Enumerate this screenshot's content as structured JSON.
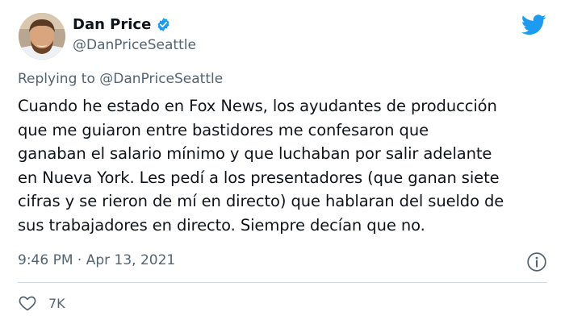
{
  "author": {
    "name": "Dan Price",
    "handle": "@DanPriceSeattle"
  },
  "reply_to": "Replying to @DanPriceSeattle",
  "body_lines": [
    "Cuando he estado en Fox News, los ayudantes de producción",
    "que me guiaron entre bastidores me confesaron que",
    "ganaban el salario mínimo y que luchaban por salir adelante",
    "en Nueva York. Les pedí a los presentadores (que ganan siete",
    "cifras y se rieron de mí en directo) que hablaran del sueldo de",
    "sus trabajadores en directo. Siempre decían que no."
  ],
  "meta": "9:46 PM · Apr 13, 2021",
  "likes": "7K",
  "colors": {
    "twitter_blue": "#1d9bf0",
    "secondary_text": "#536471"
  },
  "icons": [
    "verified-badge-icon",
    "twitter-bird-icon",
    "info-icon",
    "heart-icon"
  ]
}
